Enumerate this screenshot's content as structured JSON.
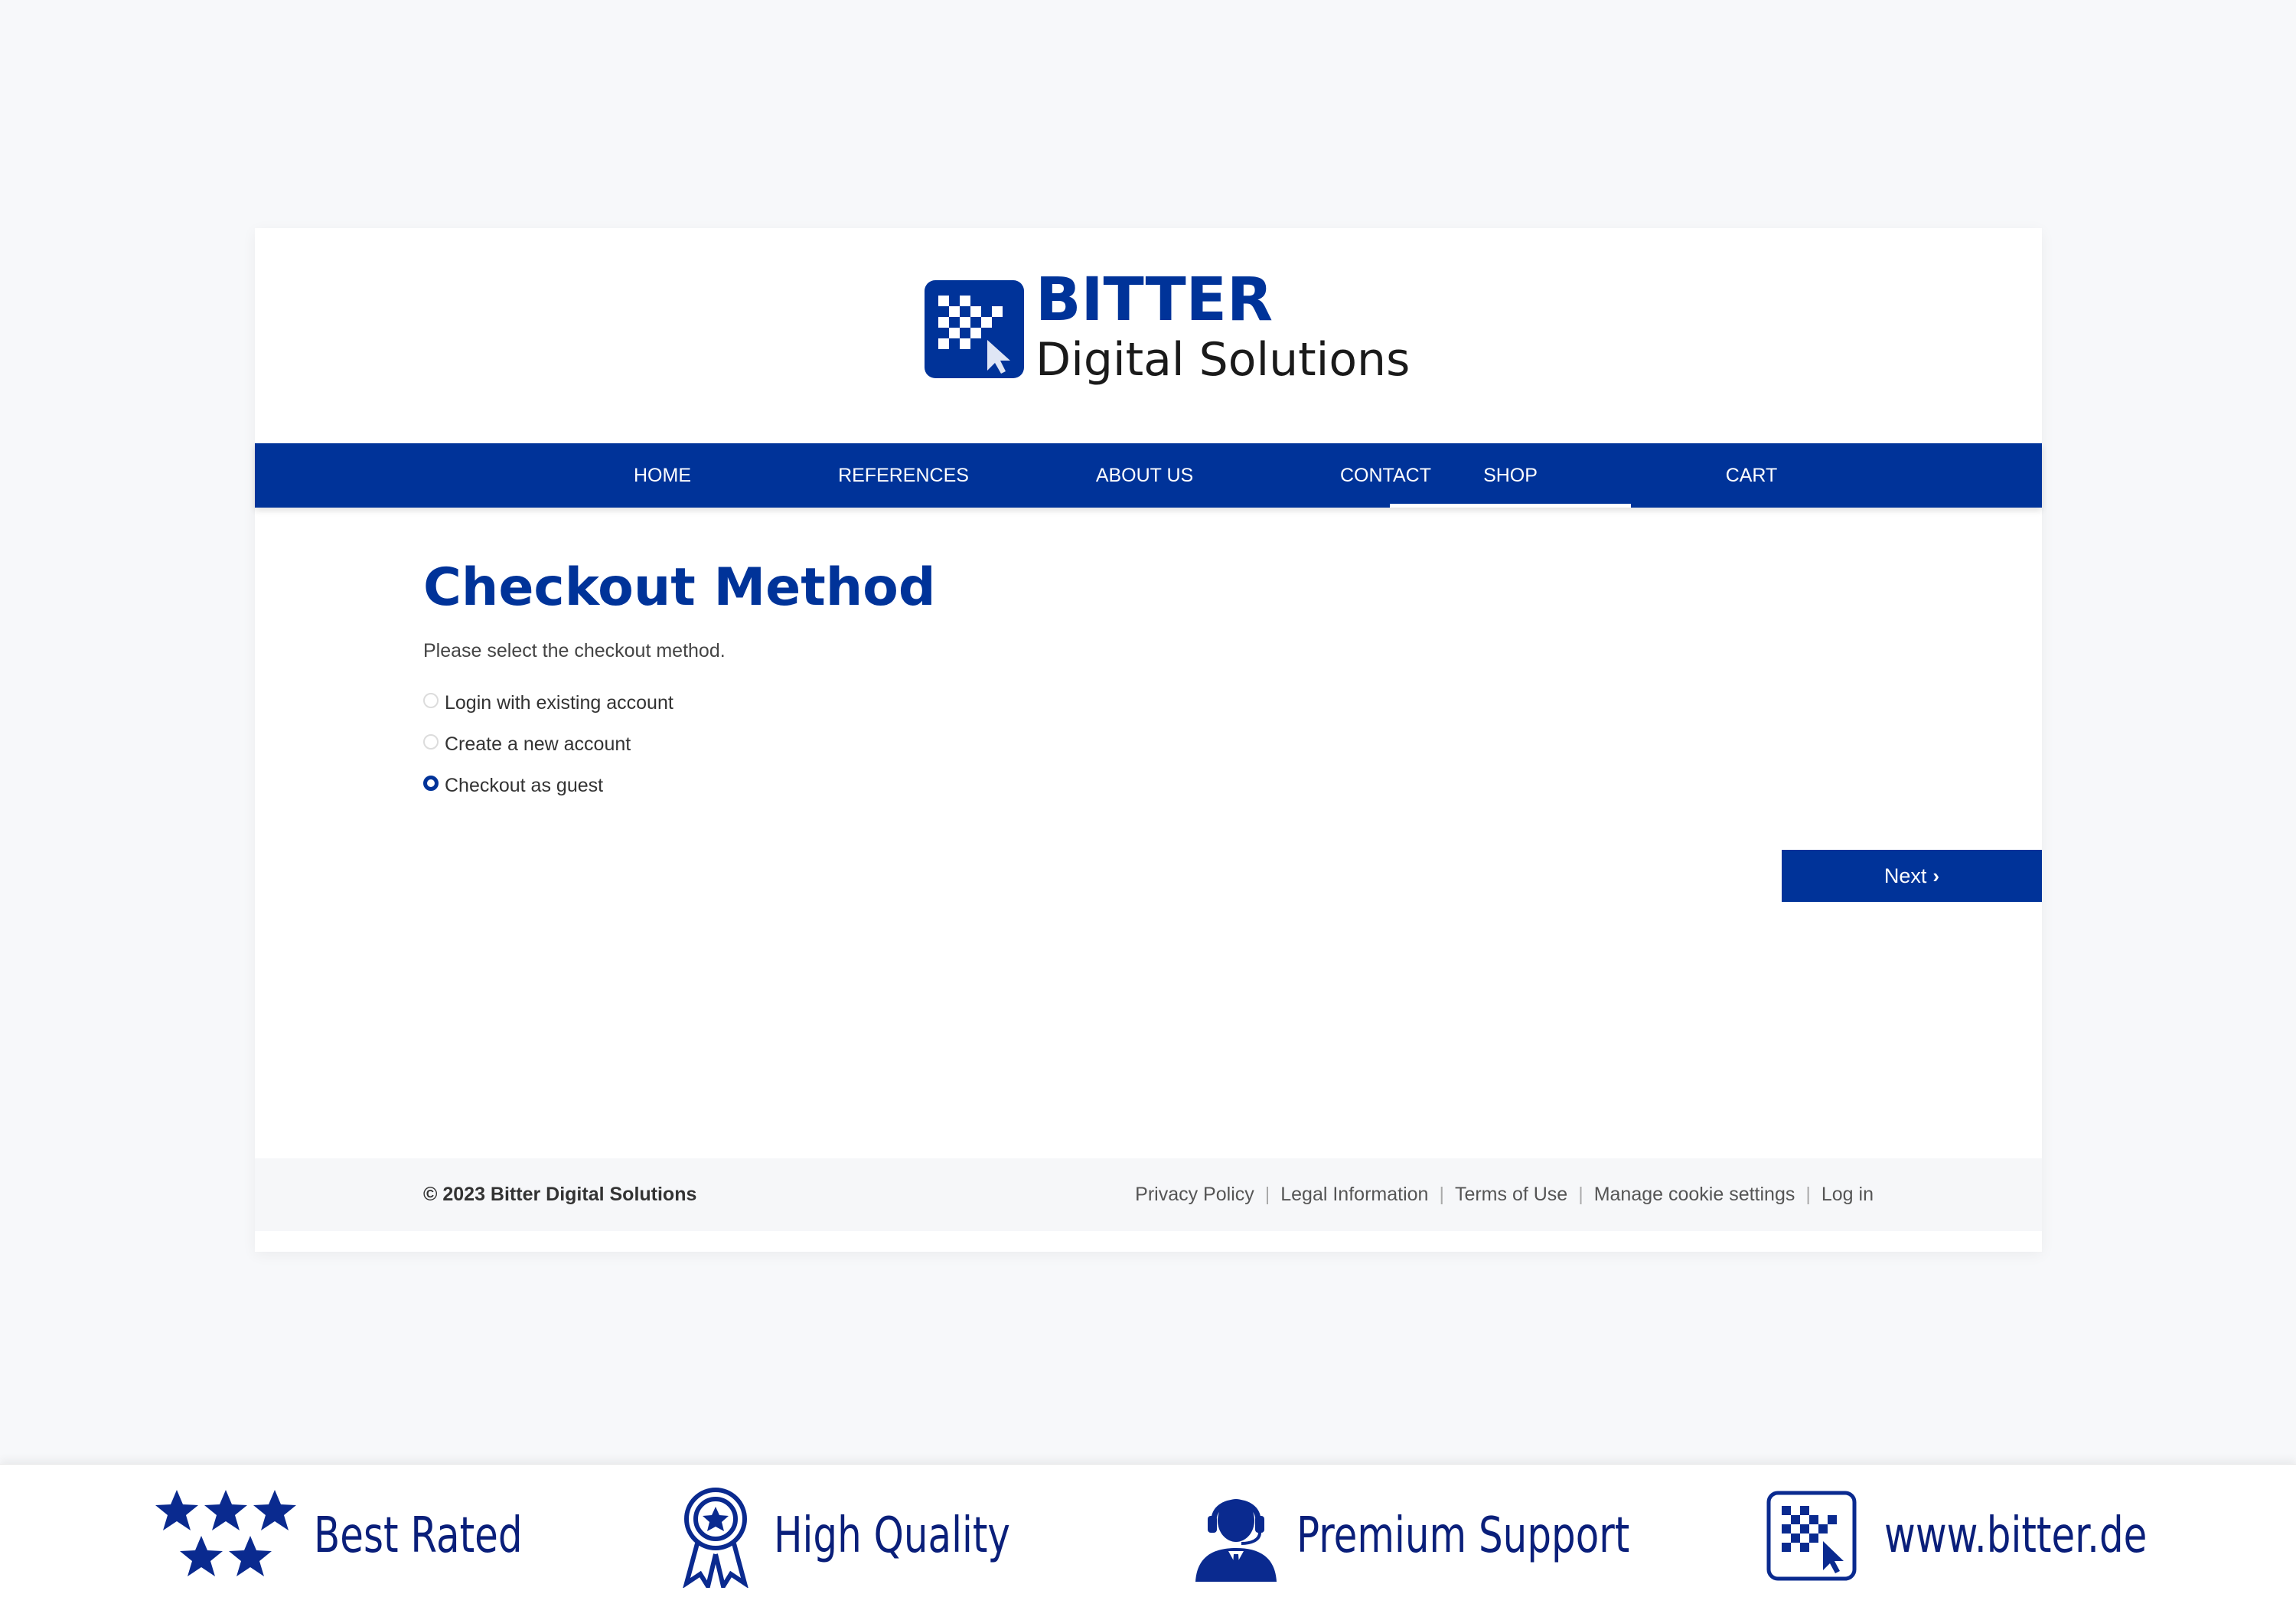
{
  "brand": {
    "title": "BITTER",
    "subtitle": "Digital Solutions",
    "color": "#003399"
  },
  "nav": {
    "items": [
      {
        "label": "HOME",
        "active": false
      },
      {
        "label": "REFERENCES",
        "active": false
      },
      {
        "label": "ABOUT US",
        "active": false
      },
      {
        "label": "CONTACT",
        "active": false
      },
      {
        "label": "SHOP",
        "active": true
      },
      {
        "label": "CART",
        "active": false
      }
    ]
  },
  "main": {
    "title": "Checkout Method",
    "subtitle": "Please select the checkout method.",
    "options": [
      {
        "label": "Login with existing account",
        "selected": false
      },
      {
        "label": "Create a new account",
        "selected": false
      },
      {
        "label": "Checkout as guest",
        "selected": true
      }
    ],
    "next_label": "Next",
    "next_icon": "chevron-right-icon"
  },
  "footer": {
    "copyright": "© 2023 Bitter Digital Solutions",
    "links": [
      "Privacy Policy",
      "Legal Information",
      "Terms of Use",
      "Manage cookie settings",
      "Log in"
    ]
  },
  "trust_bar": {
    "items": [
      {
        "icon": "stars-icon",
        "label": "Best Rated"
      },
      {
        "icon": "award-ribbon-icon",
        "label": "High Quality"
      },
      {
        "icon": "support-agent-icon",
        "label": "Premium Support"
      },
      {
        "icon": "bitter-logo-icon",
        "label": "www.bitter.de"
      }
    ]
  }
}
